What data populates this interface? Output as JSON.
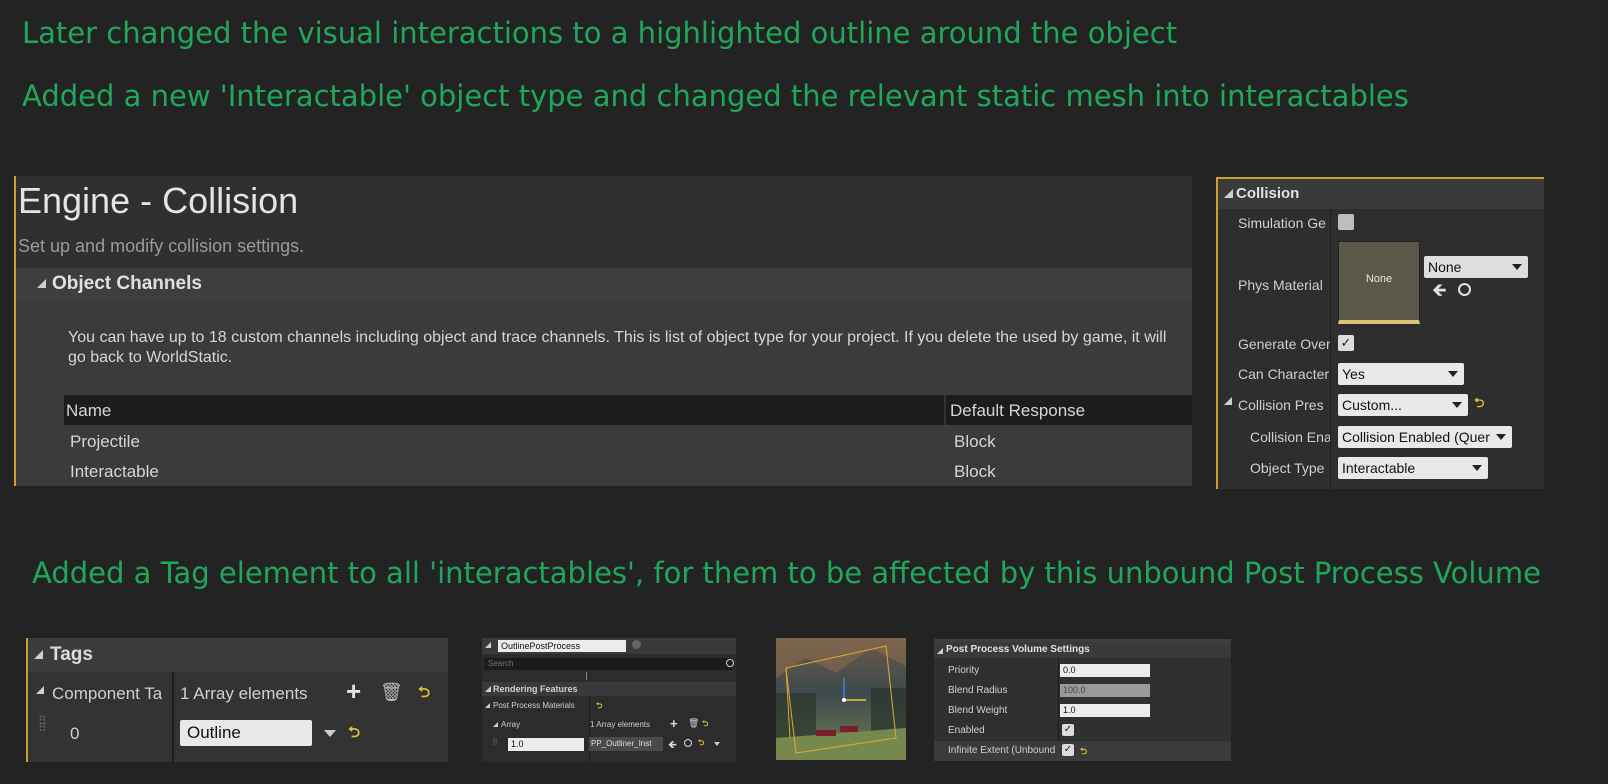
{
  "captions": {
    "line1": "Later changed the visual interactions to a highlighted outline around the object",
    "line2": "Added a new 'Interactable' object type and changed the relevant static mesh into interactables",
    "line3": "Added a Tag element to all 'interactables', for them to be affected by this unbound Post Process Volume"
  },
  "engine_collision": {
    "title": "Engine - Collision",
    "subtitle": "Set up and modify collision settings.",
    "section": "Object Channels",
    "description": "You can have up to 18 custom channels including object and trace channels. This is list of object type for your project. If you delete the used by game, it will go back to WorldStatic.",
    "columns": [
      "Name",
      "Default Response"
    ],
    "rows": [
      {
        "name": "Projectile",
        "response": "Block"
      },
      {
        "name": "Interactable",
        "response": "Block"
      }
    ]
  },
  "collision_panel": {
    "header": "Collision",
    "simulation_label": "Simulation Ge",
    "phys_material_label": "Phys Material",
    "phys_material_thumb": "None",
    "phys_material_value": "None",
    "generate_overlap_label": "Generate Over",
    "can_character_label": "Can Character",
    "can_character_value": "Yes",
    "collision_presets_label": "Collision Pres",
    "collision_presets_value": "Custom...",
    "collision_enabled_label": "Collision Ena",
    "collision_enabled_value": "Collision Enabled (Quer",
    "object_type_label": "Object Type",
    "object_type_value": "Interactable"
  },
  "tags_panel": {
    "header": "Tags",
    "component_tags_label": "Component Ta",
    "array_count": "1 Array elements",
    "index": "0",
    "value": "Outline"
  },
  "pp_panel": {
    "name_value": "OutlinePostProcess",
    "search_placeholder": "Search",
    "rendering_features": "Rendering Features",
    "post_process_materials": "Post Process Materials",
    "array_label": "Array",
    "array_count": "1 Array elements",
    "weight_value": "1.0",
    "material_value": "PP_Outliner_Inst"
  },
  "ppv_panel": {
    "header": "Post Process Volume Settings",
    "rows": [
      {
        "label": "Priority",
        "value": "0.0"
      },
      {
        "label": "Blend Radius",
        "value": "100.0"
      },
      {
        "label": "Blend Weight",
        "value": "1.0"
      },
      {
        "label": "Enabled",
        "value": ""
      },
      {
        "label": "Infinite Extent (Unbound",
        "value": ""
      }
    ]
  },
  "colors": {
    "caption_green": "#1fa85b",
    "accent_gold": "#c9a227",
    "reset_yellow": "#e2c32b"
  }
}
